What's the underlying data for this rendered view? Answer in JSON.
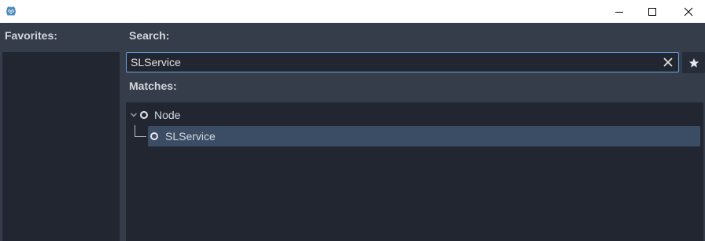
{
  "titlebar": {
    "app_icon": "godot-icon",
    "buttons": [
      "minimize-icon",
      "maximize-icon",
      "close-icon"
    ]
  },
  "favorites": {
    "label": "Favorites:"
  },
  "search": {
    "label": "Search:",
    "value": "SLService",
    "clear_icon": "clear-icon"
  },
  "favorite_toggle": {
    "icon": "star-icon"
  },
  "matches": {
    "label": "Matches:",
    "tree": [
      {
        "label": "Node",
        "expanded": true,
        "icon": "node-circle-icon"
      },
      {
        "label": "SLService",
        "selected": true,
        "icon": "node-circle-icon"
      }
    ]
  },
  "colors": {
    "background": "#363d4a",
    "panel": "#212631",
    "accent": "#6ba5e6",
    "selection": "#3b4d64"
  }
}
